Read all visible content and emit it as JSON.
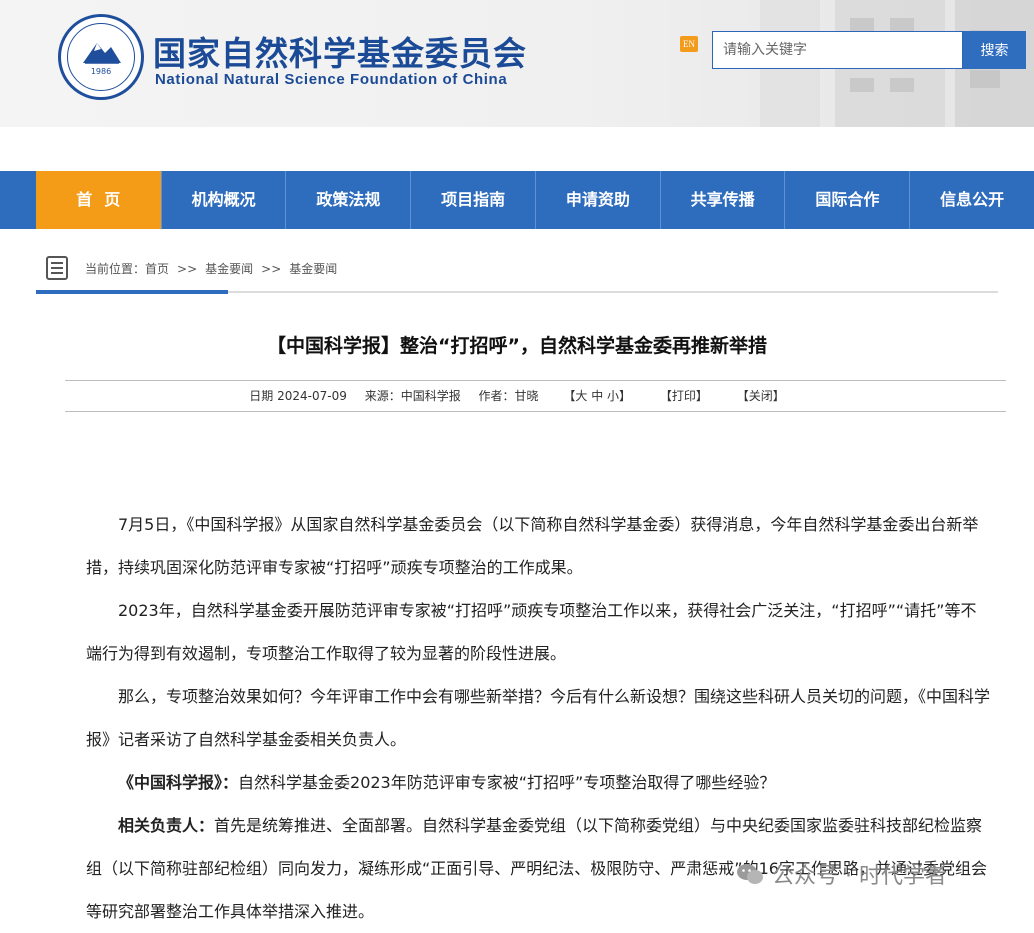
{
  "header": {
    "logo_year": "1986",
    "site_title_cn": "国家自然科学基金委员会",
    "site_title_en": "National Natural Science Foundation of China",
    "lang_switch": "EN",
    "search": {
      "placeholder": "请输入关键字",
      "button_label": "搜索"
    }
  },
  "nav": {
    "items": [
      {
        "label": "首页",
        "active": true
      },
      {
        "label": "机构概况"
      },
      {
        "label": "政策法规"
      },
      {
        "label": "项目指南"
      },
      {
        "label": "申请资助"
      },
      {
        "label": "共享传播"
      },
      {
        "label": "国际合作"
      },
      {
        "label": "信息公开"
      }
    ]
  },
  "breadcrumb": {
    "prefix": "当前位置：",
    "items": [
      "首页",
      "基金要闻",
      "基金要闻"
    ],
    "separator": ">>"
  },
  "article": {
    "title": "【中国科学报】整治“打招呼”，自然科学基金委再推新举措",
    "meta": {
      "date": "日期 2024-07-09",
      "source": "来源：中国科学报",
      "author": "作者：甘晓",
      "font_size": "【大 中 小】",
      "print": "【打印】",
      "close": "【关闭】"
    },
    "paragraphs": [
      {
        "text": "7月5日，《中国科学报》从国家自然科学基金委员会（以下简称自然科学基金委）获得消息，今年自然科学基金委出台新举措，持续巩固深化防范评审专家被“打招呼”顽疾专项整治的工作成果。"
      },
      {
        "text": "2023年，自然科学基金委开展防范评审专家被“打招呼”顽疾专项整治工作以来，获得社会广泛关注，“打招呼”“请托”等不端行为得到有效遏制，专项整治工作取得了较为显著的阶段性进展。"
      },
      {
        "text": "那么，专项整治效果如何？今年评审工作中会有哪些新举措？今后有什么新设想？围绕这些科研人员关切的问题，《中国科学报》记者采访了自然科学基金委相关负责人。"
      },
      {
        "bold": "《中国科学报》：",
        "text": "自然科学基金委2023年防范评审专家被“打招呼”专项整治取得了哪些经验？"
      },
      {
        "bold": "相关负责人：",
        "text": "首先是统筹推进、全面部署。自然科学基金委党组（以下简称委党组）与中央纪委国家监委驻科技部纪检监察组（以下简称驻部纪检组）同向发力，凝练形成“正面引导、严明纪法、极限防守、严肃惩戒”的16字工作思路，并通过委党组会等研究部署整治工作具体举措深入推进。"
      }
    ]
  },
  "watermark": {
    "text": "公众号 · 时代学者"
  },
  "colors": {
    "brand_blue": "#2e6cbd",
    "nav_active": "#f49b18",
    "title_blue": "#1b4a96"
  }
}
